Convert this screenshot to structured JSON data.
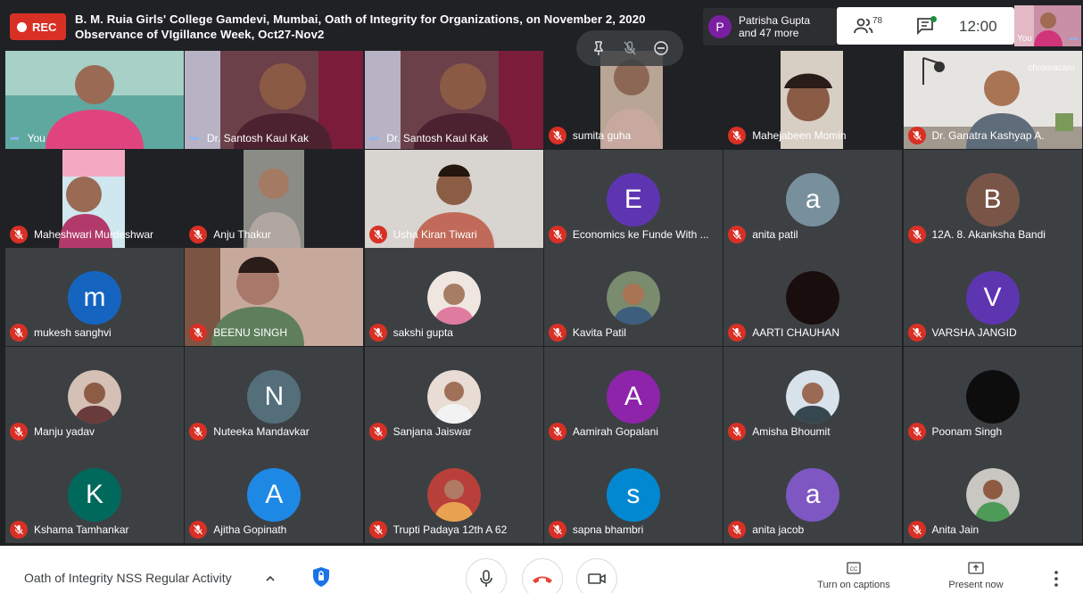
{
  "topbar": {
    "rec_label": "REC",
    "title_line1": "B. M. Ruia Girls' College Gamdevi, Mumbai, Oath of Integrity for Organizations,  on November 2, 2020",
    "title_line2": "Observance of VIgillance Week, Oct27-Nov2",
    "presenter_initial": "P",
    "presenter_name": "Patrisha Gupta",
    "presenter_more": "and 47 more",
    "participants_count": "78",
    "clock": "12:00",
    "self_label": "You",
    "self_dots": "•••"
  },
  "colors": {
    "mic_off": "#d93025",
    "accent": "#8ab4f8",
    "end_call": "#ea4335",
    "tile_bg": "#3c4043",
    "page_bg": "#202124"
  },
  "tiles": [
    {
      "name": "You",
      "dots": "•••",
      "muted": false
    },
    {
      "name": "Dr. Santosh Kaul Kak",
      "dots": "•••",
      "muted": false
    },
    {
      "name": "Dr. Santosh Kaul Kak",
      "dots": "•••",
      "muted": false
    },
    {
      "name": "sumita guha",
      "muted": true
    },
    {
      "name": "Mahejabeen Momin",
      "muted": true
    },
    {
      "name": "Dr. Ganatra Kashyap A.",
      "muted": true,
      "overlay_text": "chromacam"
    },
    {
      "name": "Maheshwari Murdeshwar",
      "muted": true
    },
    {
      "name": "Anju Thakur",
      "muted": true
    },
    {
      "name": "Usha Kiran Tiwari",
      "muted": true
    },
    {
      "name": "Economics ke Funde With ...",
      "muted": true,
      "initial": "E",
      "color": "#5e35b1"
    },
    {
      "name": "anita patil",
      "muted": true,
      "initial": "a",
      "color": "#78909c"
    },
    {
      "name": "12A. 8. Akanksha Bandi",
      "muted": true,
      "initial": "B",
      "color": "#795548"
    },
    {
      "name": "mukesh sanghvi",
      "muted": true,
      "initial": "m",
      "color": "#1565c0"
    },
    {
      "name": "BEENU SINGH",
      "muted": true
    },
    {
      "name": "sakshi gupta",
      "muted": true
    },
    {
      "name": "Kavita Patil",
      "muted": true
    },
    {
      "name": "AARTI CHAUHAN",
      "muted": true
    },
    {
      "name": "VARSHA JANGID",
      "muted": true,
      "initial": "V",
      "color": "#5e35b1"
    },
    {
      "name": "Manju yadav",
      "muted": true
    },
    {
      "name": "Nuteeka Mandavkar",
      "muted": true,
      "initial": "N",
      "color": "#546e7a"
    },
    {
      "name": "Sanjana Jaiswar",
      "muted": true
    },
    {
      "name": "Aamirah Gopalani",
      "muted": true,
      "initial": "A",
      "color": "#8e24aa"
    },
    {
      "name": "Amisha Bhoumit",
      "muted": true
    },
    {
      "name": "Poonam Singh",
      "muted": true
    },
    {
      "name": "Kshama Tamhankar",
      "muted": true,
      "initial": "K",
      "color": "#00695c"
    },
    {
      "name": "Ajitha Gopinath",
      "muted": true,
      "initial": "A",
      "color": "#1e88e5"
    },
    {
      "name": "Trupti Padaya 12th A 62",
      "muted": true
    },
    {
      "name": "sapna bhambri",
      "muted": true,
      "initial": "s",
      "color": "#0288d1"
    },
    {
      "name": "anita jacob",
      "muted": true,
      "initial": "a",
      "color": "#7e57c2"
    },
    {
      "name": "Anita Jain",
      "muted": true
    }
  ],
  "bottombar": {
    "meeting_title": "Oath of Integrity NSS Regular Activity",
    "chevron": "^",
    "captions_label": "Turn on captions",
    "present_label": "Present now"
  }
}
